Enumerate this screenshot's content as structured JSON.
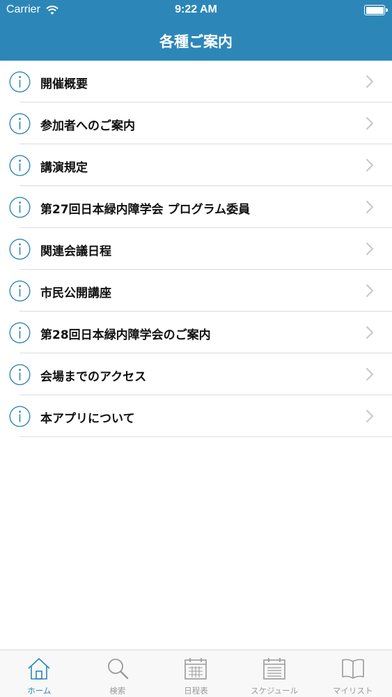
{
  "status_bar": {
    "carrier": "Carrier",
    "time": "9:22 AM",
    "battery_level": 1.0
  },
  "header": {
    "title": "各種ご案内",
    "color": "#2c87b8"
  },
  "menu": {
    "items": [
      {
        "label": "開催概要",
        "icon": "info-icon"
      },
      {
        "label": "参加者へのご案内",
        "icon": "info-icon"
      },
      {
        "label": "講演規定",
        "icon": "info-icon"
      },
      {
        "label": "第27回日本緑内障学会 プログラム委員",
        "icon": "info-icon"
      },
      {
        "label": "関連会議日程",
        "icon": "info-icon"
      },
      {
        "label": "市民公開講座",
        "icon": "info-icon"
      },
      {
        "label": "第28回日本緑内障学会のご案内",
        "icon": "info-icon"
      },
      {
        "label": "会場までのアクセス",
        "icon": "info-icon"
      },
      {
        "label": "本アプリについて",
        "icon": "info-icon"
      }
    ]
  },
  "tab_bar": {
    "tabs": [
      {
        "label": "ホーム",
        "icon": "home-icon",
        "active": true
      },
      {
        "label": "検索",
        "icon": "search-icon",
        "active": false
      },
      {
        "label": "日程表",
        "icon": "calendar-icon",
        "active": false
      },
      {
        "label": "スケジュール",
        "icon": "schedule-icon",
        "active": false
      },
      {
        "label": "マイリスト",
        "icon": "book-icon",
        "active": false
      }
    ],
    "active_color": "#2c87b8",
    "inactive_color": "#9a9a9a"
  }
}
